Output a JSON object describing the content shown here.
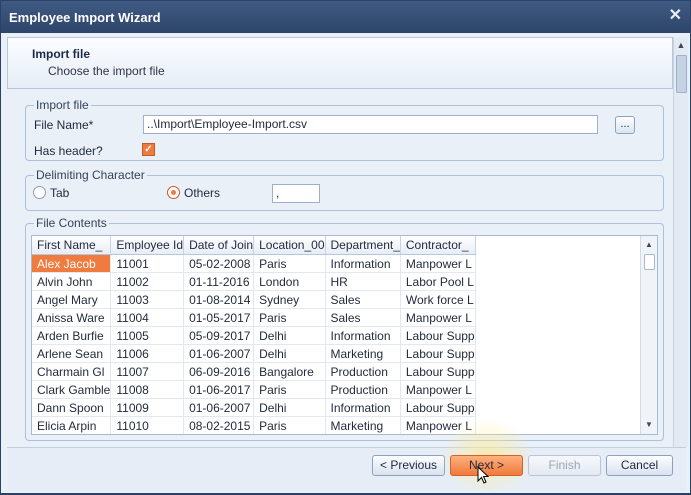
{
  "window": {
    "title": "Employee Import Wizard"
  },
  "header": {
    "title": "Import file",
    "subtitle": "Choose the import file"
  },
  "import_file": {
    "group_label": "Import file",
    "file_name_label": "File Name*",
    "file_name_value": "..\\Import\\Employee-Import.csv",
    "browse_label": "...",
    "has_header_label": "Has header?",
    "has_header_checked": true
  },
  "delimiter": {
    "group_label": "Delimiting Character",
    "tab_label": "Tab",
    "others_label": "Others",
    "selected": "Others",
    "others_value": ","
  },
  "file_contents": {
    "group_label": "File Contents",
    "columns": [
      "First Name_",
      "Employee Id",
      "Date of Join",
      "Location_00",
      "Department_",
      "Contractor_"
    ],
    "rows": [
      [
        "Alex Jacob",
        "11001",
        "05-02-2008",
        "Paris",
        "Information",
        "Manpower L"
      ],
      [
        "Alvin John",
        "11002",
        "01-11-2016",
        "London",
        "HR",
        "Labor Pool L"
      ],
      [
        "Angel Mary",
        "11003",
        "01-08-2014",
        "Sydney",
        "Sales",
        "Work force L"
      ],
      [
        "Anissa Ware",
        "11004",
        "01-05-2017",
        "Paris",
        "Sales",
        "Manpower L"
      ],
      [
        "Arden Burfie",
        "11005",
        "05-09-2017",
        "Delhi",
        "Information",
        "Labour Supp"
      ],
      [
        "Arlene Sean",
        "11006",
        "01-06-2007",
        "Delhi",
        "Marketing",
        "Labour Supp"
      ],
      [
        "Charmain Gl",
        "11007",
        "06-09-2016",
        "Bangalore",
        "Production",
        "Labour Supp"
      ],
      [
        "Clark Gamble",
        "11008",
        "01-06-2017",
        "Paris",
        "Production",
        "Manpower L"
      ],
      [
        "Dann Spoon",
        "11009",
        "01-06-2007",
        "Delhi",
        "Information",
        "Labour Supp"
      ],
      [
        "Elicia Arpin",
        "11010",
        "08-02-2015",
        "Paris",
        "Marketing",
        "Manpower L"
      ]
    ],
    "selected_row": 0
  },
  "buttons": {
    "previous": "< Previous",
    "next": "Next >",
    "finish": "Finish",
    "cancel": "Cancel"
  },
  "colors": {
    "accent": "#f07b3f",
    "title_bar": "#334d75"
  }
}
